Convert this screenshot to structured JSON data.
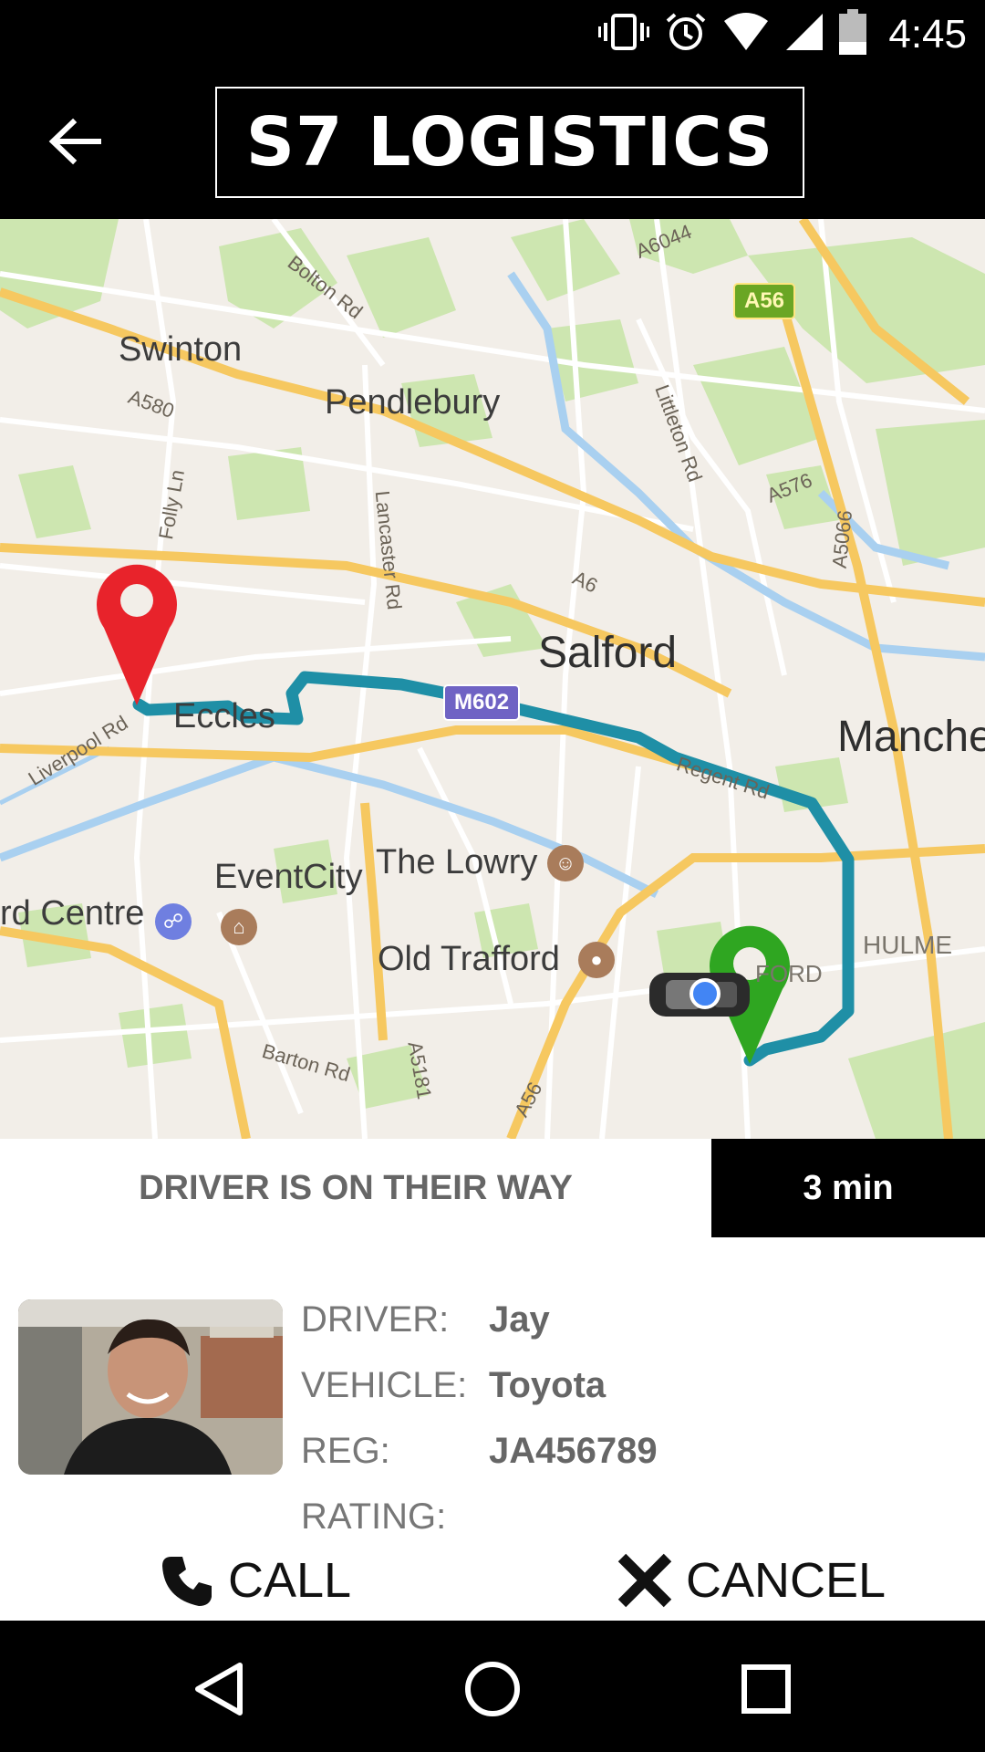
{
  "status_bar": {
    "time": "4:45",
    "icons": [
      "vibrate-icon",
      "alarm-icon",
      "wifi-icon",
      "signal-icon",
      "battery-icon"
    ]
  },
  "app_bar": {
    "title": "S7 LOGISTICS",
    "back_icon": "arrow-left-icon"
  },
  "map": {
    "places": {
      "swinton": "Swinton",
      "pendlebury": "Pendlebury",
      "salford": "Salford",
      "eccles": "Eccles",
      "manchester": "Manche",
      "eventcity": "EventCity",
      "lowry": "The Lowry",
      "old_trafford": "Old Trafford",
      "trafford_centre": "rd Centre",
      "hulme": "HULME",
      "ford": "FORD"
    },
    "roads": {
      "bolton_rd": "Bolton Rd",
      "a580": "A580",
      "folly_ln": "Folly Ln",
      "lancaster_rd": "Lancaster Rd",
      "littleton_rd": "Littleton Rd",
      "a576": "A576",
      "a5066": "A5066",
      "a6": "A6",
      "a6044": "A6044",
      "liverpool_rd": "Liverpool Rd",
      "regent_rd": "Regent Rd",
      "barton_rd": "Barton Rd",
      "a5181": "A5181",
      "a56_lower": "A56"
    },
    "shields": {
      "m602": "M602",
      "a56": "A56"
    },
    "colors": {
      "route": "#1f8fa6",
      "destination_pin": "#e8232b",
      "pickup_pin": "#2fa621",
      "driver_dot": "#4285f4"
    }
  },
  "trip_status": {
    "message": "DRIVER IS ON THEIR WAY",
    "eta": "3 min"
  },
  "driver": {
    "labels": {
      "driver": "DRIVER:",
      "vehicle": "VEHICLE:",
      "reg": "REG:",
      "rating": "RATING:"
    },
    "name": "Jay",
    "vehicle": "Toyota",
    "reg": "JA456789",
    "rating": ""
  },
  "actions": {
    "call_label": "CALL",
    "cancel_label": "CANCEL",
    "call_icon": "phone-icon",
    "cancel_icon": "close-icon"
  },
  "nav_bar": {
    "buttons": [
      "back-triangle-icon",
      "home-circle-icon",
      "recents-square-icon"
    ]
  }
}
